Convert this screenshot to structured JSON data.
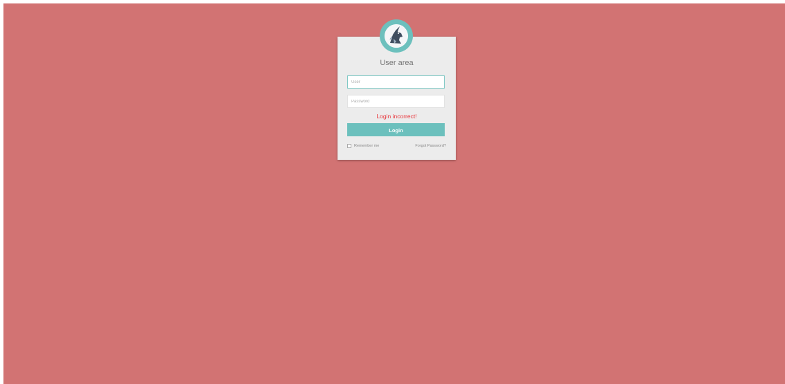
{
  "colors": {
    "background": "#d27373",
    "card": "#ececec",
    "accent": "#6cc0bd",
    "error": "#e8383e"
  },
  "login": {
    "title": "User area",
    "avatar_icon": "unicorn-logo-icon",
    "user_placeholder": "User",
    "user_value": "",
    "password_placeholder": "Password",
    "password_value": "",
    "error_message": "Login incorrect!",
    "submit_label": "Login",
    "remember_label": "Remember me",
    "remember_checked": false,
    "forgot_label": "Forgot Password?"
  }
}
